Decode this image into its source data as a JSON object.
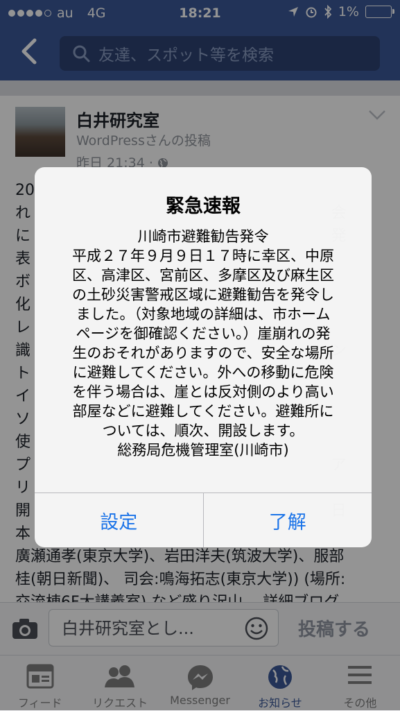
{
  "status": {
    "carrier": "au",
    "network": "4G",
    "time": "18:21",
    "battery": "1%"
  },
  "search": {
    "placeholder": "友達、スポット等を検索"
  },
  "post": {
    "author": "白井研究室",
    "subtitle": "WordPressさんの投稿",
    "time": "昨日 21:34 ·",
    "lines": [
      "20",
      "れ                                                              会",
      "に                                                              発",
      "表",
      "ボ",
      "化",
      "レ",
      "識                                                              ン",
      "ト",
      "イ",
      "ソ",
      "使",
      "プ                                                              ア",
      "リ",
      "開                                                              日",
      "本",
      "廣瀬通孝(東京大学)、岩田洋夫(筑波大学)、服部",
      "桂(朝日新聞)、 司会:鳴海拓志(東京大学)) (場所:",
      "交流棟6F大講義室) など盛り沢山。 詳細ブログ"
    ]
  },
  "composer": {
    "placeholder": "白井研究室とし...",
    "post_label": "投稿する"
  },
  "tabs": [
    {
      "label": "フィード"
    },
    {
      "label": "リクエスト"
    },
    {
      "label": "Messenger"
    },
    {
      "label": "お知らせ"
    },
    {
      "label": "その他"
    }
  ],
  "alert": {
    "title": "緊急速報",
    "message": "川崎市避難勧告発令\n平成２７年９月９日１７時に幸区、中原\n区、高津区、宮前区、多摩区及び麻生区\nの土砂災害警戒区域に避難勧告を発令し\nました。（対象地域の詳細は、市ホーム\nページを御確認ください。）崖崩れの発\n生のおそれがありますので、安全な場所\nに避難してください。外への移動に危険\nを伴う場合は、崖とは反対側のより高い\n部屋などに避難してください。避難所に\nついては、順次、開設します。\n総務局危機管理室(川崎市)",
    "button_settings": "設定",
    "button_ok": "了解"
  },
  "colors": {
    "brand": "#3b5998",
    "alert_button": "#1a73e8"
  }
}
